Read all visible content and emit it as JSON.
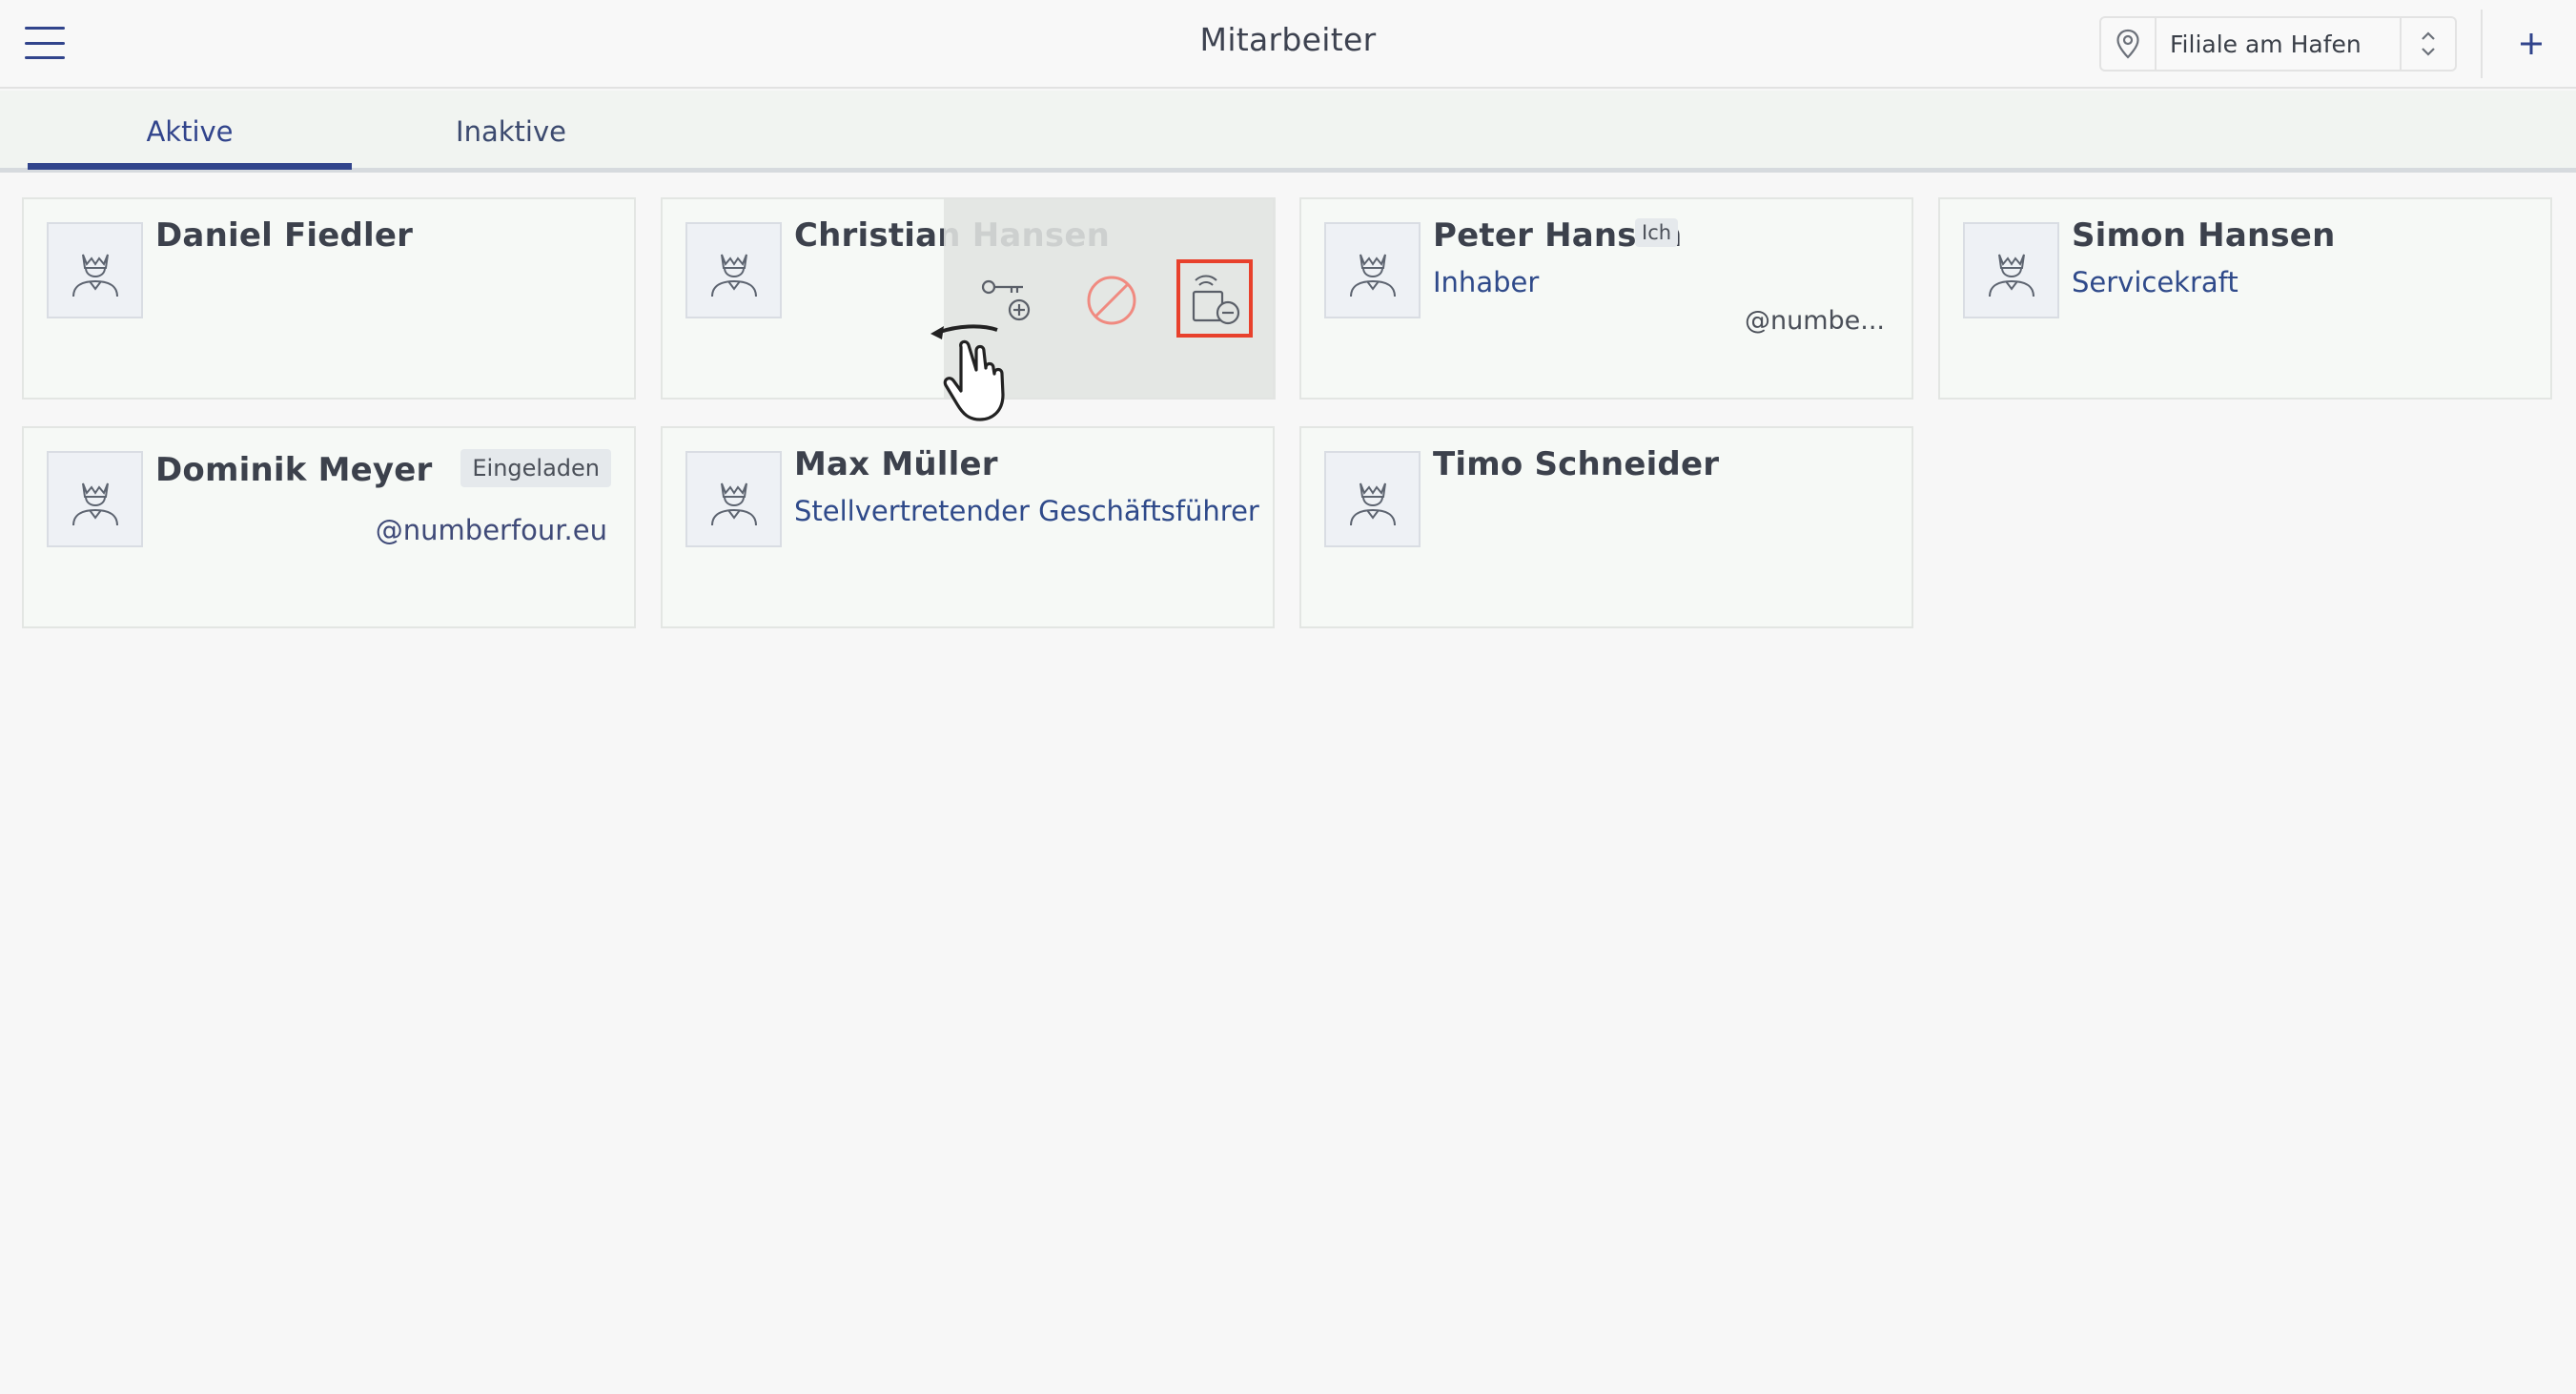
{
  "header": {
    "title": "Mitarbeiter",
    "location": "Filiale am Hafen",
    "menu_icon": "hamburger-menu-icon",
    "add_icon": "plus-icon"
  },
  "tabs": [
    {
      "label": "Aktive",
      "active": true
    },
    {
      "label": "Inaktive",
      "active": false
    }
  ],
  "employees": [
    {
      "name": "Daniel Fiedler",
      "role": "",
      "email": "",
      "badge": ""
    },
    {
      "name": "Christian Hansen",
      "role": "",
      "email": "",
      "badge": ""
    },
    {
      "name": "Peter Hansen",
      "role": "Inhaber",
      "email": "@numbe...",
      "badge": "Ich"
    },
    {
      "name": "Simon Hansen",
      "role": "Servicekraft",
      "email": "",
      "badge": ""
    },
    {
      "name": "Dominik Meyer",
      "role": "",
      "email": "@numberfour.eu",
      "badge": "Eingeladen"
    },
    {
      "name": "Max Müller",
      "role": "Stellvertretender Geschäftsführer",
      "email": "",
      "badge": ""
    },
    {
      "name": "Timo Schneider",
      "role": "",
      "email": "",
      "badge": ""
    }
  ],
  "swipe_actions": [
    {
      "name": "add-key-icon",
      "color": "#5a5f68"
    },
    {
      "name": "block-icon",
      "color": "#f08a80"
    },
    {
      "name": "remove-device-icon",
      "color": "#5a5f68",
      "highlighted": true
    }
  ],
  "colors": {
    "accent": "#31448c",
    "highlight": "#e8412c",
    "card_bg": "#f6f9f6"
  }
}
